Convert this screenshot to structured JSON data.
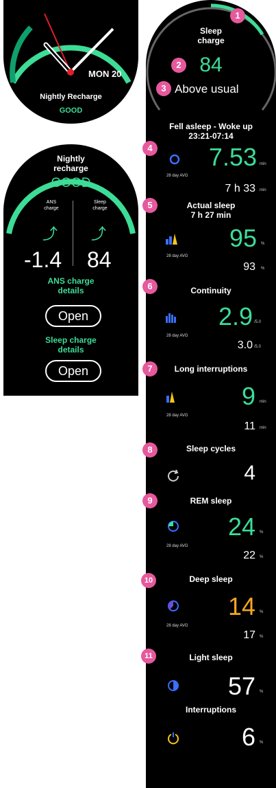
{
  "watch_face": {
    "date": "MON 20",
    "label": "Nightly Recharge",
    "status": "GOOD"
  },
  "recharge_summary": {
    "title_line1": "Nightly",
    "title_line2": "recharge",
    "status": "GOOD",
    "ans_label_line1": "ANS",
    "ans_label_line2": "charge",
    "sleep_label_line1": "Sleep",
    "sleep_label_line2": "charge",
    "ans_value": "-1.4",
    "sleep_value": "84",
    "ans_link_line1": "ANS charge",
    "ans_link_line2": "details",
    "ans_button": "Open",
    "sleep_link_line1": "Sleep charge",
    "sleep_link_line2": "details",
    "sleep_button": "Open"
  },
  "sleep_detail": {
    "charge_title_line1": "Sleep",
    "charge_title_line2": "charge",
    "charge_value": "84",
    "charge_compare": "Above usual",
    "fell_asleep_label": "Fell asleep - Woke up",
    "fell_asleep_range": "23:21-07:14",
    "avg_label": "28 day AVG",
    "sleep_time": {
      "value": "7.53",
      "unit": "min",
      "avg": "7 h 33",
      "avg_unit": "min"
    },
    "actual_sleep": {
      "title": "Actual sleep",
      "subtitle": "7 h 27 min",
      "value": "95",
      "unit": "%",
      "avg": "93",
      "avg_unit": "%"
    },
    "continuity": {
      "title": "Continuity",
      "value": "2.9",
      "unit": "/5.0",
      "avg": "3.0",
      "avg_unit": "/5.0"
    },
    "long_interruptions": {
      "title": "Long interruptions",
      "value": "9",
      "unit": "min",
      "avg": "11",
      "avg_unit": "min"
    },
    "sleep_cycles": {
      "title": "Sleep cycles",
      "value": "4"
    },
    "rem_sleep": {
      "title": "REM sleep",
      "value": "24",
      "unit": "%",
      "avg": "22",
      "avg_unit": "%"
    },
    "deep_sleep": {
      "title": "Deep sleep",
      "value": "14",
      "unit": "%",
      "avg": "17",
      "avg_unit": "%"
    },
    "light_sleep": {
      "title": "Light sleep",
      "value": "57",
      "unit": "%"
    },
    "interruptions": {
      "title": "Interruptions",
      "value": "6",
      "unit": "%"
    }
  },
  "badges": [
    "1",
    "2",
    "3",
    "4",
    "5",
    "6",
    "7",
    "8",
    "9",
    "10",
    "11"
  ],
  "colors": {
    "accent_green": "#3ddc97",
    "highlight_orange": "#f5a623",
    "badge_pink": "#e6599c",
    "hand_red": "#e01f2a"
  }
}
